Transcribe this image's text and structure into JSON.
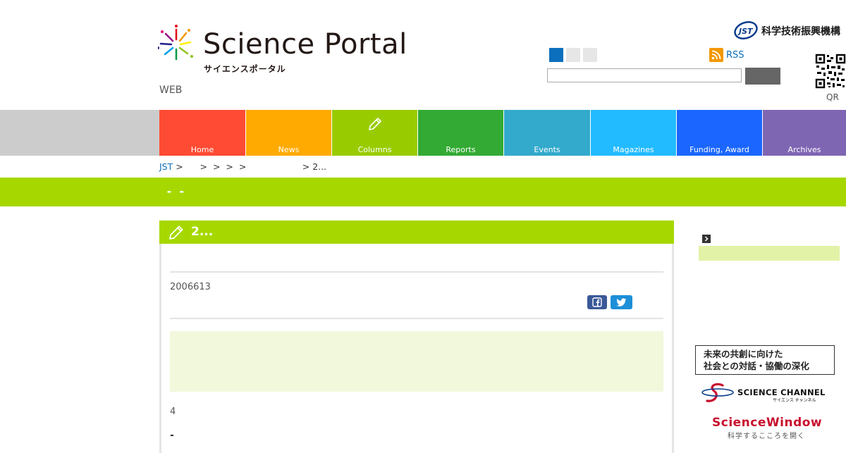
{
  "header": {
    "logo_title": "Science Portal",
    "logo_subtitle": "サイエンスポータル",
    "web_label": "WEB",
    "jst_org_name": "科学技術振興機構",
    "rss_label": "RSS",
    "qr_label": "QR",
    "text_size_colors": [
      "#0b6fbd",
      "#e6e6e6",
      "#e6e6e6"
    ]
  },
  "nav": {
    "items": [
      {
        "label": "Home",
        "color": "#ff4b33"
      },
      {
        "label": "News",
        "color": "#ffaa00"
      },
      {
        "label": "Columns",
        "color": "#99cc00"
      },
      {
        "label": "Reports",
        "color": "#33aa33"
      },
      {
        "label": "Events",
        "color": "#33aacc"
      },
      {
        "label": "Magazines",
        "color": "#22bbff"
      },
      {
        "label": "Funding, Award",
        "color": "#1a66ff"
      },
      {
        "label": "Archives",
        "color": "#7f66b3"
      }
    ]
  },
  "breadcrumb": {
    "root": "JST",
    "rest": " >      >  >  >  >                    > 2..."
  },
  "band": {
    "title": " -  -"
  },
  "article": {
    "title": "2...",
    "date": "2006613",
    "paragraph_count": "4",
    "dash": "-"
  },
  "sidebar": {
    "banner_kyoso_line1": "未来の共創に向けた",
    "banner_kyoso_line2": "社会との対話・協働の深化",
    "science_channel": "SCIENCE CHANNEL",
    "science_channel_sub": "サイエンス チャンネル",
    "science_window": "ScienceWindow",
    "science_window_sub": "科学するこころを開く"
  },
  "colors": {
    "accent_green": "#a6d800",
    "link_blue": "#0b6fbd",
    "facebook": "#3b5998",
    "twitter": "#1da1f2"
  }
}
